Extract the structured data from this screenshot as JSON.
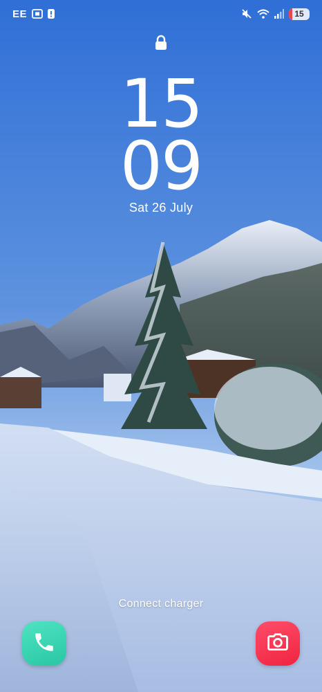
{
  "status_bar": {
    "carrier": "EE",
    "left_icons": [
      "screen-record-icon",
      "alert-icon"
    ],
    "right_icons": [
      "mute-icon",
      "wifi-icon",
      "signal-icon"
    ],
    "battery_level": "15",
    "battery_color": "#e5484d"
  },
  "lock_screen": {
    "lock_icon": "padlock-icon",
    "clock_hour": "15",
    "clock_minute": "09",
    "date": "Sat 26 July",
    "charger_message": "Connect charger"
  },
  "shortcuts": {
    "left": {
      "icon": "phone-icon",
      "color": "#2fd3ad"
    },
    "right": {
      "icon": "camera-icon",
      "color": "#f4344f"
    }
  },
  "wallpaper": {
    "description_icon": "snowy-mountain-road-wallpaper"
  }
}
